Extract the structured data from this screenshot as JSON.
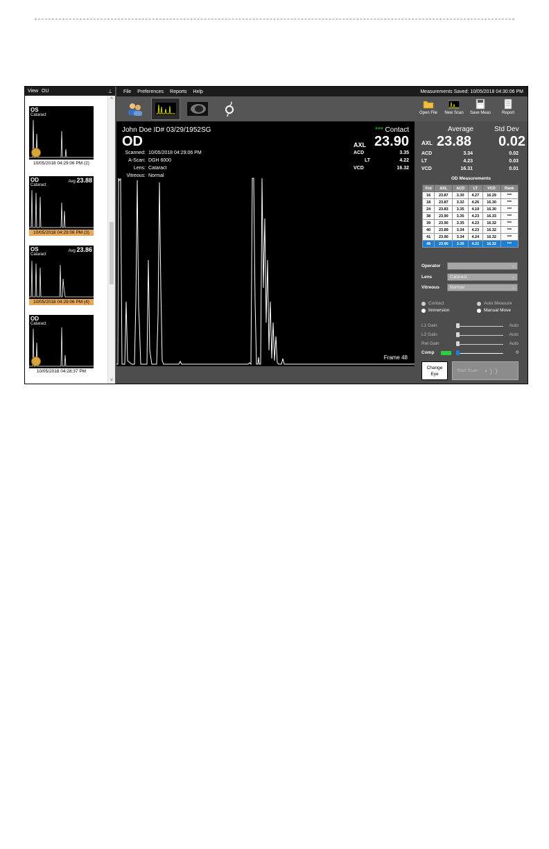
{
  "sidebar": {
    "view_label": "View",
    "view_value": "OU",
    "pin": "📌",
    "scroll_up": "^",
    "scroll_down": "v",
    "thumbs": [
      {
        "eye": "OS",
        "sub": "Cataract",
        "avg_label": "",
        "avg_value": "",
        "caption": "10/05/2018  04:29:06  PM (2)",
        "highlight": false,
        "has_reel": true
      },
      {
        "eye": "OD",
        "sub": "Cataract",
        "avg_label": "Avg",
        "avg_value": "23.88",
        "caption": "10/05/2018  04:29:06  PM (3)",
        "highlight": true,
        "has_reel": false
      },
      {
        "eye": "OS",
        "sub": "Cataract",
        "avg_label": "Avg",
        "avg_value": "23.86",
        "caption": "10/05/2018  04:29:06  PM (4)",
        "highlight": true,
        "has_reel": false
      },
      {
        "eye": "OD",
        "sub": "Cataract",
        "avg_label": "",
        "avg_value": "",
        "caption": "10/05/2018  04:28:37  PM",
        "highlight": false,
        "has_reel": true
      }
    ]
  },
  "menu": {
    "items": [
      "File",
      "Preferences",
      "Reports",
      "Help"
    ],
    "saved": "Measurements Saved:  10/05/2018  04:30:06  PM"
  },
  "toolbar": {
    "open_file": "Open File",
    "new_scan": "New Scan",
    "save_meas": "Save Meas",
    "report": "Report"
  },
  "scan": {
    "patient": "John Doe   ID# 03/29/1952SG",
    "eye": "OD",
    "scanned_label": "Scanned:",
    "scanned_value": "10/05/2018   04:29:06  PM",
    "ascan_label": "A-Scan:",
    "ascan_value": "DGH 6000",
    "lens_label": "Lens:",
    "lens_value": "Cataract",
    "vitreous_label": "Vitreous:",
    "vitreous_value": "Normal",
    "stars": "***",
    "mode": "Contact",
    "axl_label": "AXL",
    "axl_value": "23.90",
    "acd_label": "ACD",
    "acd_value": "3.35",
    "lt_label": "LT",
    "lt_value": "4.22",
    "vcd_label": "VCD",
    "vcd_value": "16.32",
    "frame": "Frame 48"
  },
  "summary": {
    "avg_header": "Average",
    "std_header": "Std Dev",
    "axl_label": "AXL",
    "axl_avg": "23.88",
    "axl_std": "0.02",
    "rows": [
      {
        "k": "ACD",
        "a": "3.34",
        "s": "0.02"
      },
      {
        "k": "LT",
        "a": "4.23",
        "s": "0.03"
      },
      {
        "k": "VCD",
        "a": "16.31",
        "s": "0.01"
      }
    ]
  },
  "measurements": {
    "title": "OD Measurements",
    "columns": [
      "Frd",
      "AXL",
      "ACD",
      "LT",
      "VCD",
      "Rank"
    ],
    "rows": [
      [
        "16",
        "23.87",
        "3.30",
        "4.27",
        "16.29",
        "***"
      ],
      [
        "18",
        "23.87",
        "3.32",
        "4.26",
        "16.30",
        "***"
      ],
      [
        "24",
        "23.83",
        "3.35",
        "4.19",
        "16.30",
        "***"
      ],
      [
        "38",
        "23.90",
        "3.35",
        "4.23",
        "16.33",
        "***"
      ],
      [
        "39",
        "23.90",
        "3.35",
        "4.23",
        "16.32",
        "***"
      ],
      [
        "40",
        "23.89",
        "3.34",
        "4.23",
        "16.32",
        "***"
      ],
      [
        "41",
        "23.90",
        "3.34",
        "4.24",
        "16.32",
        "***"
      ],
      [
        "48",
        "23.90",
        "3.35",
        "4.22",
        "16.32",
        "***"
      ]
    ],
    "selected_index": 7
  },
  "fields": {
    "operator_label": "Operator",
    "operator_value": "",
    "lens_label": "Lens",
    "lens_value": "Cataract",
    "vitreous_label": "Vitreous",
    "vitreous_value": "Normal"
  },
  "options": {
    "contact": "Contact",
    "immersion": "Immersion",
    "auto_measure": "Auto Measure",
    "manual_move": "Manual Move"
  },
  "gains": {
    "l1_label": "L1 Gain",
    "l1_value": "Auto",
    "l2_label": "L2 Gain",
    "l2_value": "Auto",
    "ret_label": "Ret Gain",
    "ret_value": "Auto",
    "comp_label": "Comp",
    "comp_value": "0"
  },
  "buttons": {
    "change_eye_line1": "Change",
    "change_eye_line2": "Eye",
    "start_scan": "Start Scan"
  },
  "colors": {
    "highlight": "#e8a85a",
    "selected_row": "#1c7fd6",
    "stars": "#2ecc40",
    "comp_swatch": "#2ecc40"
  }
}
